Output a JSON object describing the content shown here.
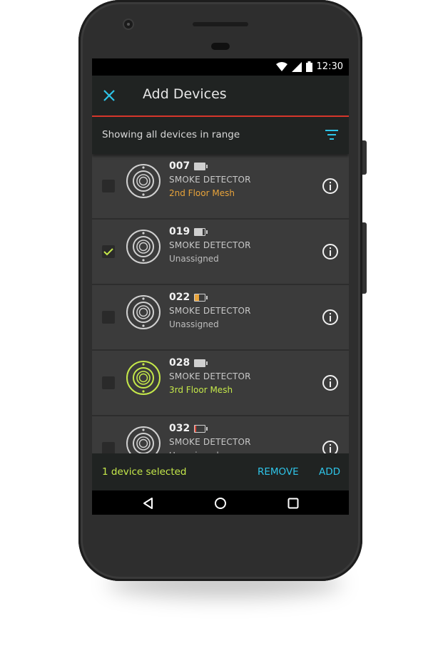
{
  "status_bar": {
    "time": "12:30"
  },
  "app_bar": {
    "title": "Add Devices",
    "close_icon": "close-icon"
  },
  "filter_bar": {
    "text": "Showing all devices in range",
    "filter_icon": "filter-icon"
  },
  "colors": {
    "accent": "#2ec4e8",
    "divider_red": "#d9372c",
    "selected_green": "#c5e84a",
    "group_orange": "#e8a33a",
    "battery_low_red": "#e04a3a"
  },
  "devices": [
    {
      "id": "007",
      "type": "SMOKE DETECTOR",
      "group": "2nd Floor Mesh",
      "group_color": "#e8a33a",
      "checked": false,
      "battery_level": 1.0,
      "battery_color": "#cfcfcf",
      "highlighted": false
    },
    {
      "id": "019",
      "type": "SMOKE DETECTOR",
      "group": "Unassigned",
      "group_color": "#bdbdbd",
      "checked": true,
      "battery_level": 0.75,
      "battery_color": "#cfcfcf",
      "highlighted": false
    },
    {
      "id": "022",
      "type": "SMOKE DETECTOR",
      "group": "Unassigned",
      "group_color": "#bdbdbd",
      "checked": false,
      "battery_level": 0.4,
      "battery_color": "#e8a33a",
      "highlighted": false
    },
    {
      "id": "028",
      "type": "SMOKE DETECTOR",
      "group": "3rd Floor Mesh",
      "group_color": "#c5e84a",
      "checked": false,
      "battery_level": 1.0,
      "battery_color": "#cfcfcf",
      "highlighted": true
    },
    {
      "id": "032",
      "type": "SMOKE DETECTOR",
      "group": "Unassigned",
      "group_color": "#bdbdbd",
      "checked": false,
      "battery_level": 0.15,
      "battery_color": "#e04a3a",
      "highlighted": false
    }
  ],
  "bottom_bar": {
    "selected_text": "1 device selected",
    "remove_label": "REMOVE",
    "add_label": "ADD"
  }
}
